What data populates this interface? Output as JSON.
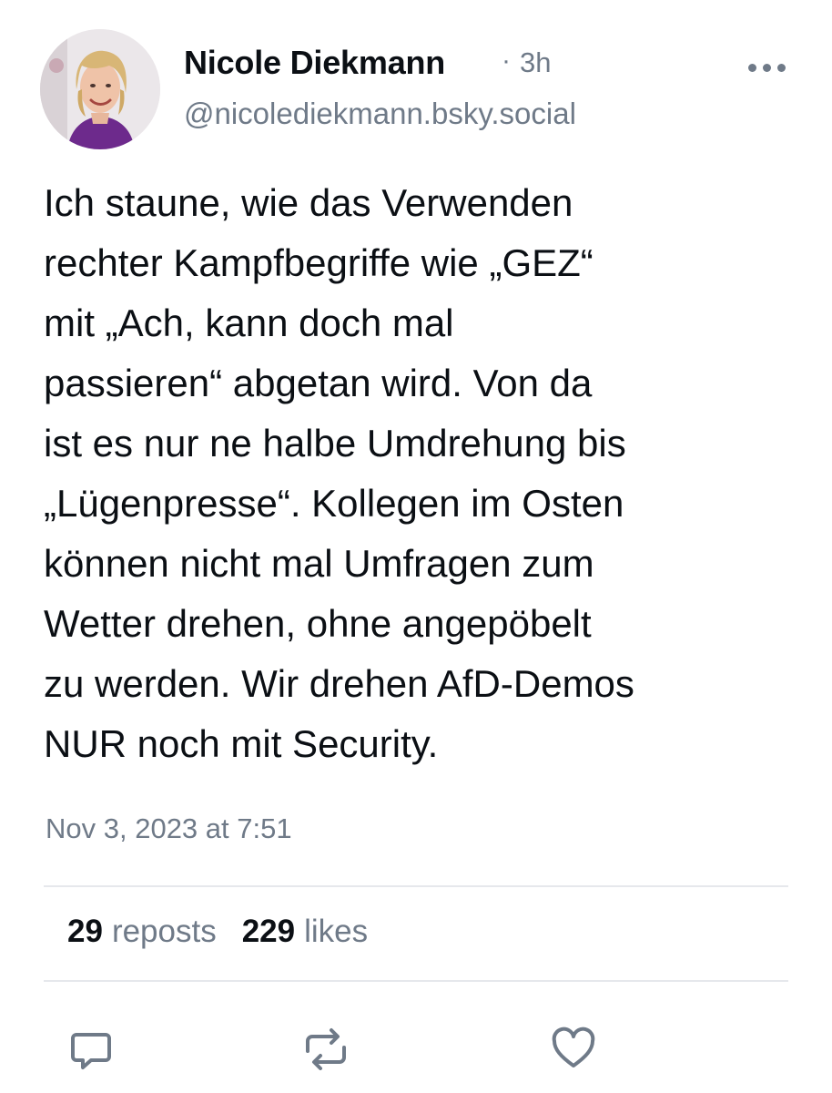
{
  "author": {
    "display_name": "Nicole Diekmann",
    "separator": "·",
    "time_ago": "3h",
    "handle": "@nicolediekmann.bsky.social",
    "avatar_icon": "profile-photo"
  },
  "post": {
    "text_lines": [
      "Ich staune, wie das Verwenden",
      "rechter Kampfbegriffe wie „GEZ“",
      "mit „Ach, kann doch mal",
      "passieren“ abgetan wird. Von da",
      "ist es nur ne halbe Umdrehung bis",
      "„Lügenpresse“. Kollegen im Osten",
      "können nicht mal Umfragen zum",
      "Wetter drehen, ohne angepöbelt",
      "zu werden. Wir drehen AfD-Demos",
      "NUR noch mit Security."
    ],
    "date": "Nov 3, 2023 at 7:51"
  },
  "stats": {
    "reposts_count": "29",
    "reposts_label": "reposts",
    "likes_count": "229",
    "likes_label": "likes"
  },
  "actions": [
    {
      "name": "reply",
      "icon": "speech-bubble-icon"
    },
    {
      "name": "repost",
      "icon": "repost-arrows-icon"
    },
    {
      "name": "like",
      "icon": "heart-icon"
    }
  ],
  "colors": {
    "text": "#0b0f14",
    "muted": "#6f7a88",
    "divider": "#e6e8ec",
    "background": "#ffffff"
  }
}
